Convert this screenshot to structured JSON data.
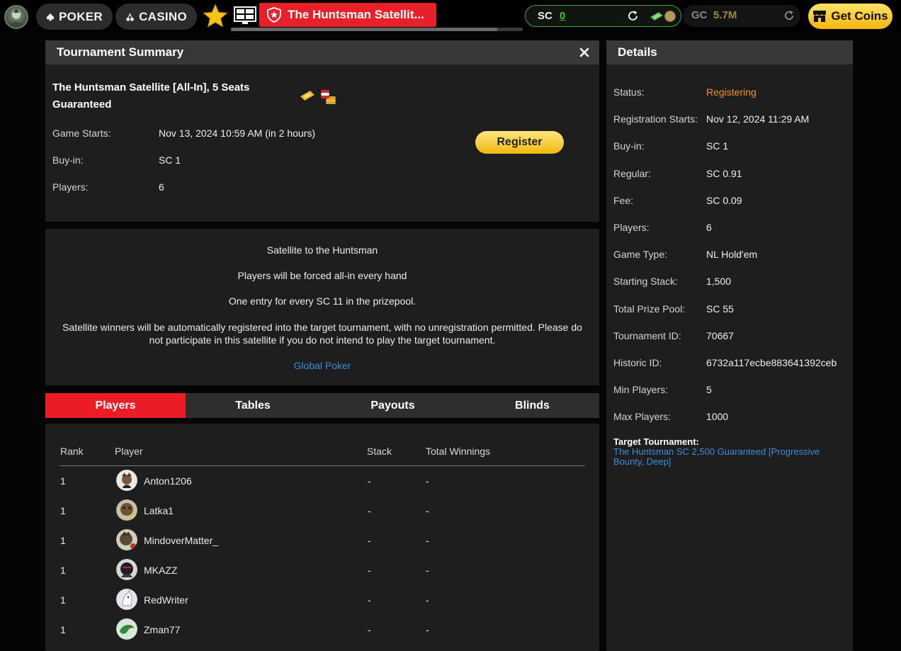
{
  "topbar": {
    "poker_label": "POKER",
    "casino_label": "CASINO",
    "active_tab_label": "The Huntsman Satellit...",
    "sc": {
      "label": "SC",
      "value": "0"
    },
    "gc": {
      "label": "GC",
      "value": "5.7M"
    },
    "get_coins_label": "Get Coins"
  },
  "summary": {
    "header": "Tournament Summary",
    "tournament_name": "The Huntsman Satellite [All-In], 5 Seats Guaranteed",
    "rows": [
      {
        "label": "Game Starts:",
        "value": "Nov 13, 2024 10:59 AM (in 2 hours)"
      },
      {
        "label": "Buy-in:",
        "value": "SC 1"
      },
      {
        "label": "Players:",
        "value": "6"
      }
    ],
    "register_label": "Register"
  },
  "description": {
    "lines": [
      "Satellite to the Huntsman",
      "Players will be forced all-in every hand",
      "One entry for every SC 11 in the prizepool.",
      "Satellite winners will be automatically registered into the target tournament, with no unregistration permitted. Please do not participate in this satellite if you do not intend to play the target tournament."
    ],
    "link": "Global Poker"
  },
  "tabs": [
    "Players",
    "Tables",
    "Payouts",
    "Blinds"
  ],
  "players_table": {
    "columns": [
      "Rank",
      "Player",
      "Stack",
      "Total Winnings"
    ],
    "rows": [
      {
        "rank": "1",
        "name": "Anton1206",
        "stack": "-",
        "winnings": "-"
      },
      {
        "rank": "1",
        "name": "Latka1",
        "stack": "-",
        "winnings": "-"
      },
      {
        "rank": "1",
        "name": "MindoverMatter_",
        "stack": "-",
        "winnings": "-"
      },
      {
        "rank": "1",
        "name": "MKAZZ",
        "stack": "-",
        "winnings": "-"
      },
      {
        "rank": "1",
        "name": "RedWriter",
        "stack": "-",
        "winnings": "-"
      },
      {
        "rank": "1",
        "name": "Zman77",
        "stack": "-",
        "winnings": "-"
      }
    ]
  },
  "details": {
    "header": "Details",
    "rows": [
      {
        "label": "Status:",
        "value": "Registering"
      },
      {
        "label": "Registration Starts:",
        "value": "Nov 12, 2024 11:29 AM"
      },
      {
        "label": "Buy-in:",
        "value": "SC 1"
      },
      {
        "label": "Regular:",
        "value": "SC 0.91"
      },
      {
        "label": "Fee:",
        "value": "SC 0.09"
      },
      {
        "label": "Players:",
        "value": "6"
      },
      {
        "label": "Game Type:",
        "value": "NL Hold'em"
      },
      {
        "label": "Starting Stack:",
        "value": "1,500"
      },
      {
        "label": "Total Prize Pool:",
        "value": "SC 55"
      },
      {
        "label": "Tournament ID:",
        "value": "70667"
      },
      {
        "label": "Historic ID:",
        "value": "6732a117ecbe883641392ceb"
      },
      {
        "label": "Min Players:",
        "value": "5"
      },
      {
        "label": "Max Players:",
        "value": "1000"
      }
    ],
    "target_label": "Target Tournament:",
    "target_link": "The Huntsman SC 2,500 Guaranteed [Progressive Bounty, Deep]"
  },
  "colors": {
    "accent_red": "#e8202a",
    "sc_green": "#3fbf3f",
    "status_orange": "#f3922a",
    "link_blue": "#3a8fd8",
    "gold": "#f3b60a"
  }
}
